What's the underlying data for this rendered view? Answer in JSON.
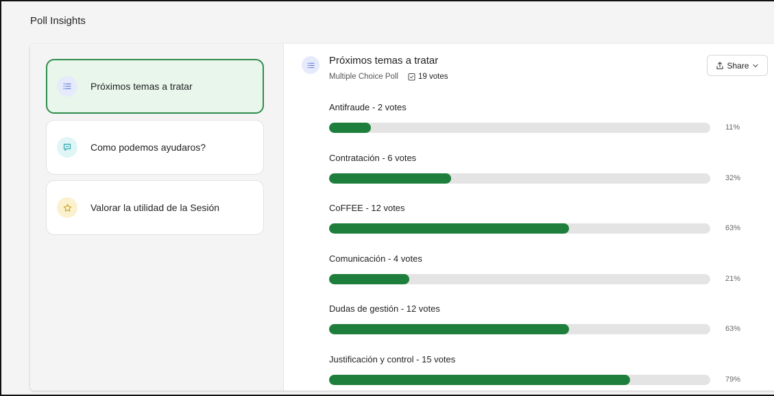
{
  "page": {
    "title": "Poll Insights"
  },
  "sidebar": {
    "polls": [
      {
        "label": "Próximos temas a tratar",
        "icon": "list-icon",
        "active": true
      },
      {
        "label": "Como podemos ayudaros?",
        "icon": "chat-icon",
        "active": false
      },
      {
        "label": "Valorar la utilidad de la Sesión",
        "icon": "star-icon",
        "active": false
      }
    ]
  },
  "poll": {
    "title": "Próximos temas a tratar",
    "type": "Multiple Choice Poll",
    "votes": "19 votes",
    "share_label": "Share",
    "options": [
      {
        "label": "Antifraude - 2 votes",
        "percent_label": "11%",
        "percent": 11
      },
      {
        "label": "Contratación - 6 votes",
        "percent_label": "32%",
        "percent": 32
      },
      {
        "label": "CoFFEE - 12 votes",
        "percent_label": "63%",
        "percent": 63
      },
      {
        "label": "Comunicación - 4 votes",
        "percent_label": "21%",
        "percent": 21
      },
      {
        "label": "Dudas de gestión - 12 votes",
        "percent_label": "63%",
        "percent": 63
      },
      {
        "label": "Justificación y control - 15 votes",
        "percent_label": "79%",
        "percent": 79
      }
    ]
  },
  "colors": {
    "accent_green": "#1e7e3c",
    "active_card_bg": "#e8f6ec",
    "active_card_border": "#2e8b4a",
    "bar_track": "#e4e4e4"
  }
}
